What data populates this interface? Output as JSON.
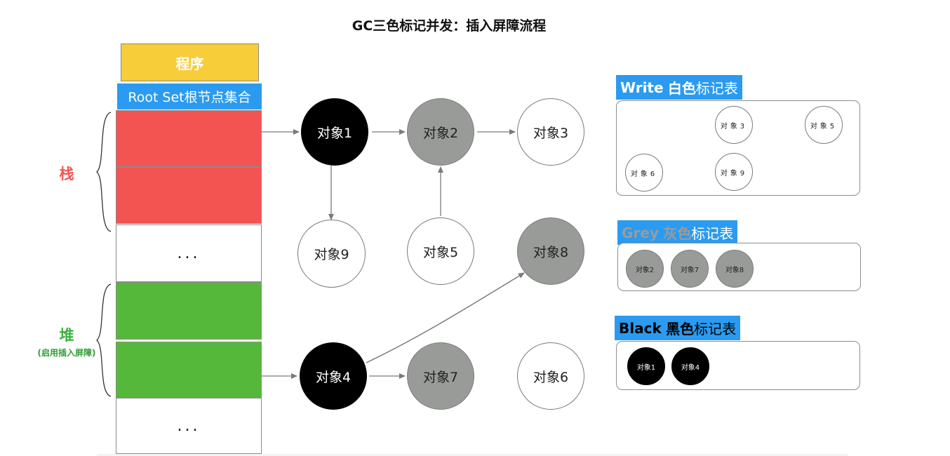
{
  "title": "GC三色标记并发：插入屏障流程",
  "program": "程序",
  "root_set": "Root Set根节点集合",
  "stack_label": "栈",
  "heap_label": "堆",
  "heap_note": "(启用插入屏障)",
  "ellipsis": "...",
  "nodes": {
    "obj1": {
      "label": "对象1",
      "color": "black"
    },
    "obj2": {
      "label": "对象2",
      "color": "grey"
    },
    "obj3": {
      "label": "对象3",
      "color": "white"
    },
    "obj9": {
      "label": "对象9",
      "color": "white"
    },
    "obj5": {
      "label": "对象5",
      "color": "white"
    },
    "obj8": {
      "label": "对象8",
      "color": "grey"
    },
    "obj4": {
      "label": "对象4",
      "color": "black"
    },
    "obj7": {
      "label": "对象7",
      "color": "grey"
    },
    "obj6": {
      "label": "对象6",
      "color": "white"
    }
  },
  "tables": {
    "white": {
      "name_en": "Write",
      "name_color": "白色",
      "suffix": "标记表",
      "items": [
        "对象3",
        "对象5",
        "对象6",
        "对象9"
      ]
    },
    "grey": {
      "name_en": "Grey",
      "name_color": "灰色",
      "suffix": "标记表",
      "items": [
        "对象2",
        "对象7",
        "对象8"
      ]
    },
    "black": {
      "name_en": "Black",
      "name_color": "黑色",
      "suffix": "标记表",
      "items": [
        "对象1",
        "对象4"
      ]
    }
  },
  "colors": {
    "program_fill": "#f7cd3a",
    "root_set_fill": "#2a9bf0",
    "stack_fill": "#f35452",
    "heap_fill": "#56b83a",
    "grey_fill": "#999b99",
    "black_fill": "#000000",
    "arrow": "#7a7a7a"
  }
}
